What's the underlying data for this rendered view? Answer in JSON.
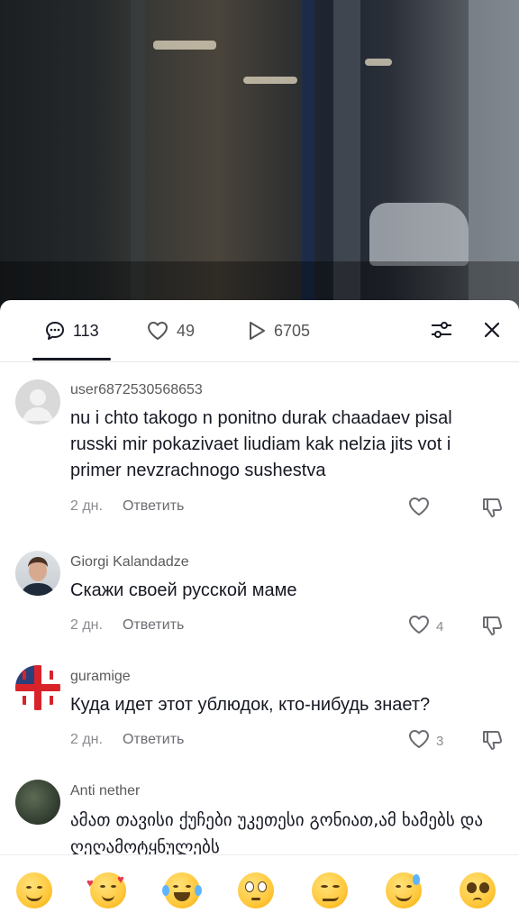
{
  "tabs": {
    "comments_count": "113",
    "likes_count": "49",
    "views_count": "6705"
  },
  "comments": [
    {
      "user": "user6872530568653",
      "text": "nu i chto takogo n ponitno durak chaadaev pisal russki mir pokazivaet liudiam kak nelzia jits vot i primer nevzrachnogo sushestva",
      "time": "2 дн.",
      "reply": "Ответить",
      "likes": ""
    },
    {
      "user": "Giorgi Kalandadze",
      "text": "Скажи своей русской маме",
      "time": "2 дн.",
      "reply": "Ответить",
      "likes": "4"
    },
    {
      "user": "guramige",
      "text": "Куда идет этот ублюдок, кто-нибудь знает?",
      "time": "2 дн.",
      "reply": "Ответить",
      "likes": "3"
    },
    {
      "user": "Anti nether",
      "text": "ამათ თავისი ქუჩები უკეთესი გონიათ,ამ ხამებს და ღეღამოტყნულებს",
      "time": "",
      "reply": "",
      "likes": ""
    }
  ],
  "emoji_bar": [
    "grinning",
    "smiling-hearts",
    "tears-of-joy",
    "flushed",
    "smirking",
    "sweat-smile",
    "pleading"
  ],
  "colors": {
    "text": "#161823",
    "muted": "#8a8b91",
    "accent_underline": "#161823"
  }
}
